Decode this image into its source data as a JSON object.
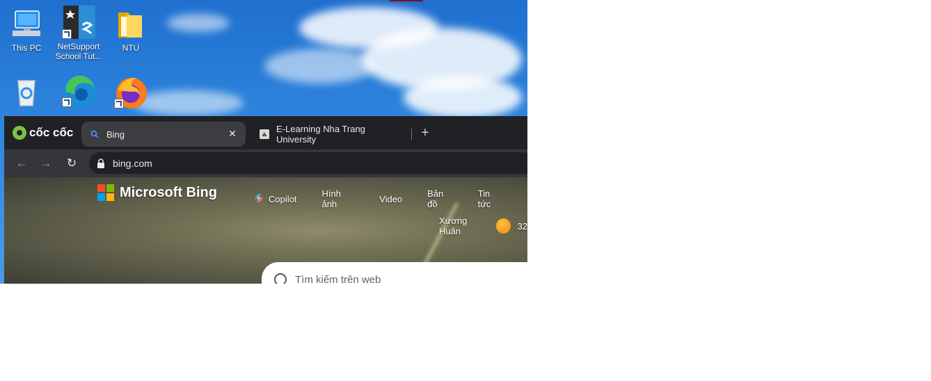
{
  "desktop": {
    "icons": [
      {
        "label": "This PC",
        "icon": "computer-icon"
      },
      {
        "label": "NetSupport School Tut...",
        "icon": "netsupport-icon"
      },
      {
        "label": "NTU",
        "icon": "folder-icon"
      },
      {
        "label": "",
        "icon": "recycle-bin-icon"
      },
      {
        "label": "",
        "icon": "edge-icon"
      },
      {
        "label": "",
        "icon": "firefox-icon"
      }
    ]
  },
  "browser": {
    "brand": "cốc cốc",
    "tabs": [
      {
        "label": "Bing",
        "active": true
      },
      {
        "label": "E-Learning Nha Trang University",
        "active": false
      }
    ],
    "address": "bing.com"
  },
  "bing": {
    "logo_text": "Microsoft Bing",
    "nav": [
      "Copilot",
      "Hình ảnh",
      "Video",
      "Bản đồ",
      "Tin tức"
    ],
    "user_name": "Xương Huân",
    "points": "32",
    "search_placeholder": "Tìm kiếm trên web"
  },
  "colors": {
    "browser_bg": "#202124",
    "toolbar_bg": "#35363a",
    "coccoc_green": "#7bc143",
    "ms_red": "#f25022",
    "ms_green": "#7fba00",
    "ms_blue": "#00a4ef",
    "ms_yellow": "#ffb900"
  }
}
